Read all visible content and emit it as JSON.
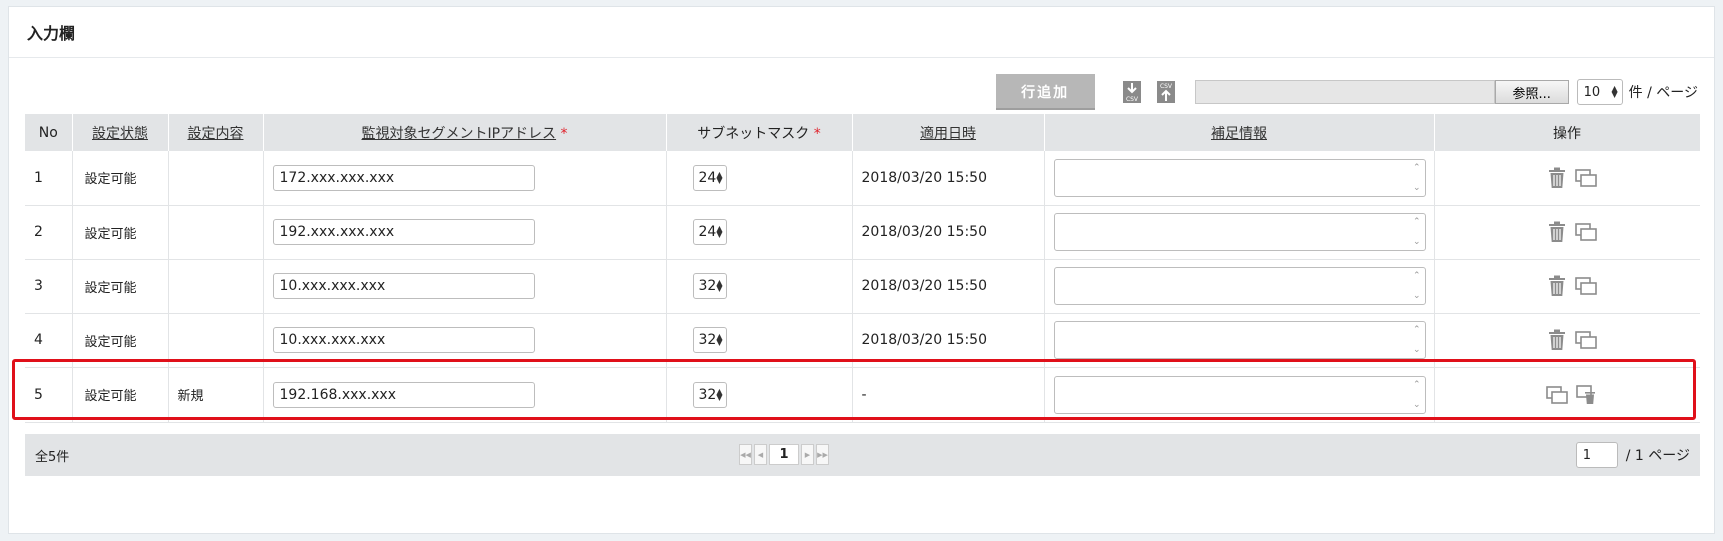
{
  "panel": {
    "title": "入力欄"
  },
  "toolbar": {
    "add_row_label": "行追加",
    "csv_download_icon": "csv-download-icon",
    "csv_upload_icon": "csv-upload-icon",
    "browse_label": "参照...",
    "per_page_value": "10",
    "per_page_suffix": "件 / ページ"
  },
  "table": {
    "headers": {
      "no": "No",
      "status": "設定状態",
      "content": "設定内容",
      "ip": "監視対象セグメントIPアドレス",
      "mask": "サブネットマスク",
      "applied": "適用日時",
      "note": "補足情報",
      "ops": "操作"
    },
    "required_mark": "*",
    "rows": [
      {
        "no": "1",
        "status": "設定可能",
        "content": "",
        "ip": "172.xxx.xxx.xxx",
        "mask": "24",
        "applied": "2018/03/20 15:50",
        "note": ""
      },
      {
        "no": "2",
        "status": "設定可能",
        "content": "",
        "ip": "192.xxx.xxx.xxx",
        "mask": "24",
        "applied": "2018/03/20 15:50",
        "note": ""
      },
      {
        "no": "3",
        "status": "設定可能",
        "content": "",
        "ip": "10.xxx.xxx.xxx",
        "mask": "32",
        "applied": "2018/03/20 15:50",
        "note": ""
      },
      {
        "no": "4",
        "status": "設定可能",
        "content": "",
        "ip": "10.xxx.xxx.xxx",
        "mask": "32",
        "applied": "2018/03/20 15:50",
        "note": ""
      },
      {
        "no": "5",
        "status": "設定可能",
        "content": "新規",
        "ip": "192.168.xxx.xxx",
        "mask": "32",
        "applied": "-",
        "note": ""
      }
    ]
  },
  "footer": {
    "total": "全5件",
    "current_page": "1",
    "page_input": "1",
    "page_total": "/ 1 ページ"
  },
  "colors": {
    "highlight": "#e0101a",
    "required": "#e0212b",
    "header_bg": "#e2e4e6"
  }
}
